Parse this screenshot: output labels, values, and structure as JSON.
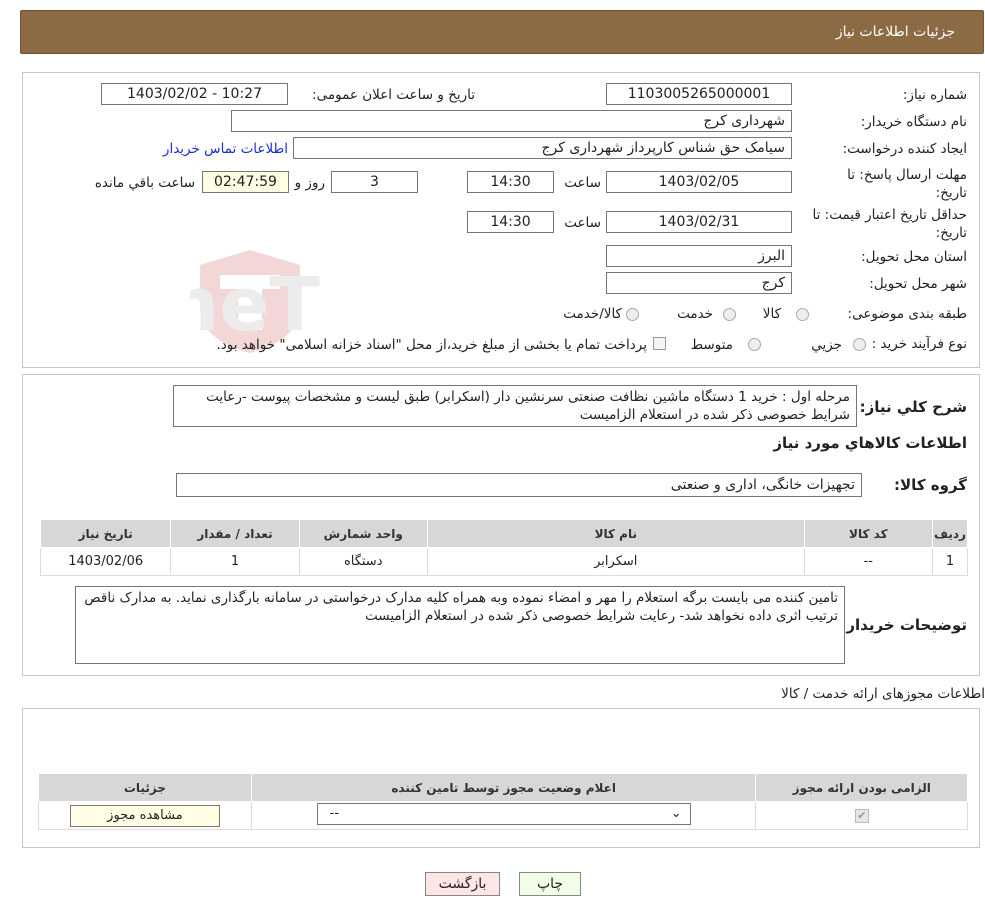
{
  "header": {
    "title": "جزئیات اطلاعات نیاز"
  },
  "form": {
    "need_number_label": "شماره نیاز:",
    "need_number": "1103005265000001",
    "announce_label": "تاریخ و ساعت اعلان عمومی:",
    "announce_value": "1403/02/02 - 10:27",
    "buyer_label": "نام دستگاه خریدار:",
    "buyer_value": "شهرداری کرج",
    "creator_label": "ایجاد کننده درخواست:",
    "creator_value": "سیامک حق شناس کارپرداز شهرداری کرج",
    "contact_link": "اطلاعات تماس خریدار",
    "deadline_label": "مهلت ارسال پاسخ: تا تاریخ:",
    "deadline_date": "1403/02/05",
    "time_label": "ساعت",
    "deadline_time": "14:30",
    "days_value": "3",
    "days_label": "روز و",
    "remaining_value": "02:47:59",
    "remaining_label": "ساعت باقي مانده",
    "validity_label": "حداقل تاریخ اعتبار قیمت: تا تاریخ:",
    "validity_date": "1403/02/31",
    "validity_time": "14:30",
    "province_label": "استان محل تحویل:",
    "province_value": "البرز",
    "city_label": "شهر محل تحویل:",
    "city_value": "کرج",
    "category_label": "طبقه بندی موضوعی:",
    "category_options": [
      "کالا",
      "خدمت",
      "کالا/خدمت"
    ],
    "process_label": "نوع فرآیند خرید :",
    "process_options": [
      "جزيي",
      "متوسط"
    ],
    "process_note": "پرداخت تمام یا بخشی از مبلغ خرید،از محل \"اسناد خزانه اسلامی\" خواهد بود."
  },
  "details": {
    "summary_label": "شرح کلي نياز:",
    "summary_text": "مرحله اول : خرید 1 دستگاه ماشین نظافت صنعتی سرنشین دار (اسکرابر) طبق لیست و مشخصات پیوست -رعایت شرایط خصوصی ذکر شده در استعلام الزامیست",
    "goods_heading": "اطلاعات کالاهاي مورد نياز",
    "group_label": "گروه کالا:",
    "group_value": "تجهیزات خانگی، اداری و صنعتی",
    "table_headers": [
      "رديف",
      "کد کالا",
      "نام کالا",
      "واحد شمارش",
      "تعداد / مقدار",
      "تاريخ نياز"
    ],
    "table_rows": [
      [
        "1",
        "--",
        "اسکرابر",
        "دستگاه",
        "1",
        "1403/02/06"
      ]
    ],
    "buyer_notes_label": "توضیحات خریدار:",
    "buyer_notes_text": "تامین کننده می بایست برگه استعلام را مهر و امضاء نموده وبه همراه کلیه مدارک درخواستی در سامانه بارگذاری نماید. به مدارک ناقص ترتیب اثری داده نخواهد شد- رعایت شرایط خصوصی ذکر شده در استعلام الزامیست"
  },
  "permits": {
    "heading": "اطلاعات مجوزهای ارائه خدمت / کالا",
    "headers": [
      "الزامی بودن ارائه مجوز",
      "اعلام وضعیت مجوز توسط تامین کننده",
      "جزئیات"
    ],
    "select_value": "--",
    "view_button": "مشاهده مجوز"
  },
  "buttons": {
    "print": "چاپ",
    "back": "بازگشت"
  },
  "watermark": {
    "text": "AriaTender.neT"
  },
  "colors": {
    "header_bg": "#8b6a44",
    "link": "#1a2fd1",
    "beige": "#fffde3",
    "back_btn": "#ffe6e6",
    "print_btn": "#f0ffe6"
  }
}
